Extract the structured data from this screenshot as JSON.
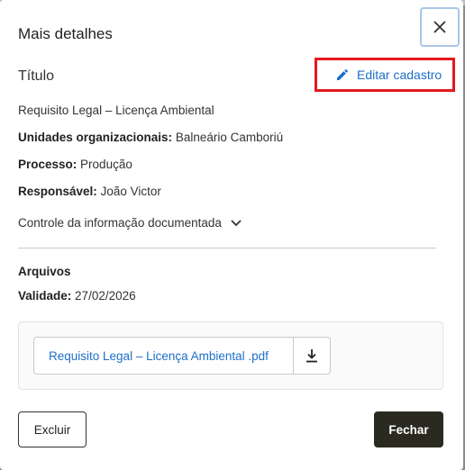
{
  "dialog": {
    "title": "Mais detalhes",
    "close_icon": "close-icon",
    "section_title": "Título",
    "edit_label": "Editar cadastro",
    "edit_icon": "pencil-icon"
  },
  "details": {
    "name": "Requisito Legal – Licença Ambiental",
    "units_label": "Unidades organizacionais:",
    "units_value": "Balneário Camboriú",
    "process_label": "Processo:",
    "process_value": "Produção",
    "responsible_label": "Responsável:",
    "responsible_value": "João Victor",
    "doc_control_label": "Controle da informação documentada"
  },
  "files": {
    "heading": "Arquivos",
    "validity_label": "Validade:",
    "validity_value": "27/02/2026",
    "items": [
      {
        "name": "Requisito Legal – Licença Ambiental .pdf",
        "icon": "download-icon"
      }
    ]
  },
  "actions": {
    "delete_label": "Excluir",
    "close_label": "Fechar"
  },
  "colors": {
    "link": "#1d6fc9",
    "highlight": "#e5191f",
    "primary_button": "#2b2a20"
  }
}
